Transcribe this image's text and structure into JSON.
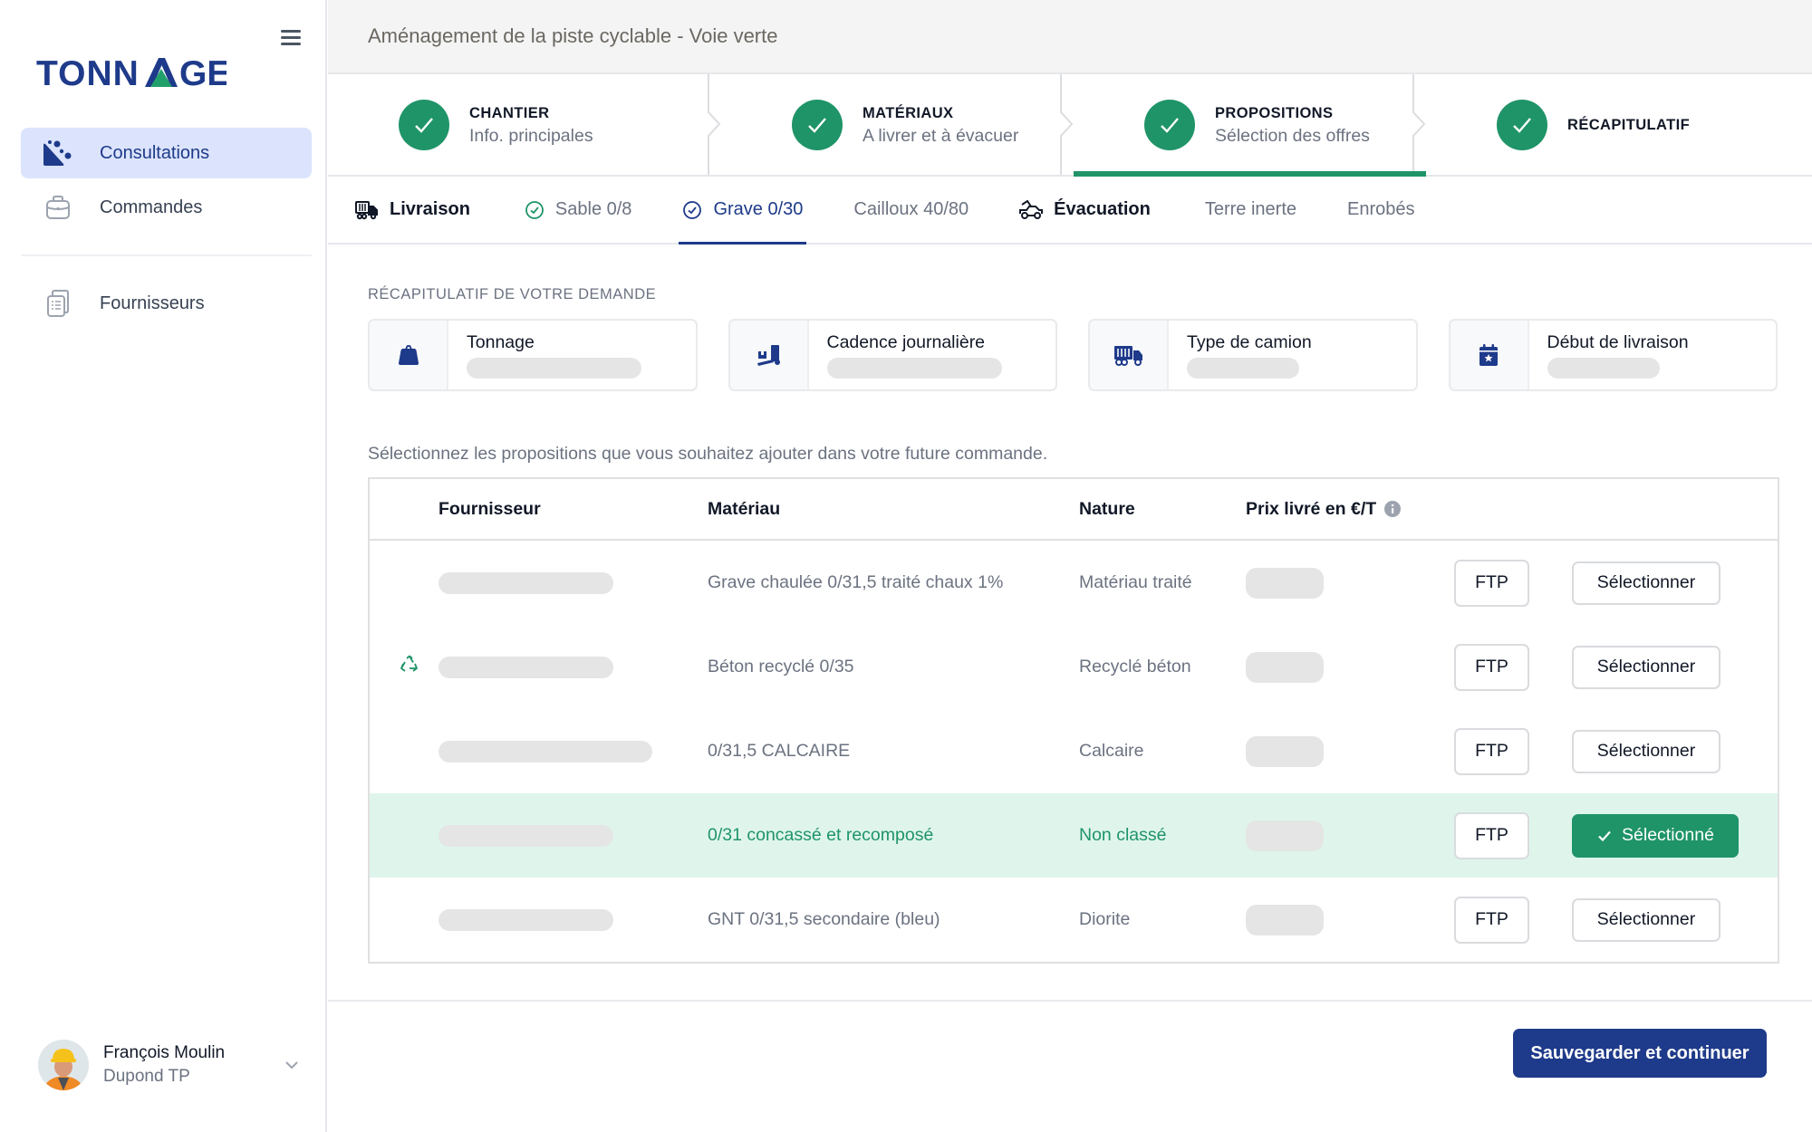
{
  "app": {
    "logo_text": "TONNAGE",
    "brand_color": "#1e3a8a",
    "accent_color": "#1f9468"
  },
  "sidebar": {
    "items": [
      {
        "label": "Consultations",
        "icon": "consultations-icon",
        "active": true
      },
      {
        "label": "Commandes",
        "icon": "briefcase-icon",
        "active": false
      },
      {
        "label": "Fournisseurs",
        "icon": "clipboard-icon",
        "active": false
      }
    ],
    "user": {
      "name": "François Moulin",
      "company": "Dupond TP"
    }
  },
  "header": {
    "title": "Aménagement de la piste cyclable - Voie verte"
  },
  "stepper": [
    {
      "title": "CHANTIER",
      "subtitle": "Info. principales",
      "status": "done"
    },
    {
      "title": "MATÉRIAUX",
      "subtitle": "A livrer et à évacuer",
      "status": "done"
    },
    {
      "title": "PROPOSITIONS",
      "subtitle": "Sélection des offres",
      "status": "active"
    },
    {
      "title": "RÉCAPITULATIF",
      "subtitle": "",
      "status": "done"
    }
  ],
  "tabs": [
    {
      "label": "Livraison",
      "type": "group",
      "icon": "delivery-truck-icon"
    },
    {
      "label": "Sable 0/8",
      "type": "done",
      "icon": "check-circle-icon"
    },
    {
      "label": "Grave 0/30",
      "type": "active",
      "icon": "check-circle-icon"
    },
    {
      "label": "Cailloux 40/80",
      "type": "default"
    },
    {
      "label": "Évacuation",
      "type": "group",
      "icon": "tow-truck-icon"
    },
    {
      "label": "Terre inerte",
      "type": "default"
    },
    {
      "label": "Enrobés",
      "type": "default"
    }
  ],
  "summary": {
    "label": "RÉCAPITULATIF DE VOTRE DEMANDE",
    "cards": [
      {
        "label": "Tonnage",
        "icon": "weight-icon"
      },
      {
        "label": "Cadence journalière",
        "icon": "hand-truck-icon"
      },
      {
        "label": "Type de camion",
        "icon": "truck-icon"
      },
      {
        "label": "Début de livraison",
        "icon": "calendar-star-icon"
      }
    ]
  },
  "proposals": {
    "hint": "Sélectionnez les propositions que vous souhaitez ajouter dans votre future commande.",
    "columns": {
      "supplier": "Fournisseur",
      "material": "Matériau",
      "nature": "Nature",
      "price": "Prix livré en €/T"
    },
    "ftp_label": "FTP",
    "select_label": "Sélectionner",
    "selected_label": "Sélectionné",
    "rows": [
      {
        "material": "Grave chaulée 0/31,5 traité chaux 1%",
        "nature": "Matériau traité",
        "recycled": false,
        "selected": false
      },
      {
        "material": "Béton recyclé 0/35",
        "nature": "Recyclé béton",
        "recycled": true,
        "selected": false
      },
      {
        "material": "0/31,5 CALCAIRE",
        "nature": "Calcaire",
        "recycled": false,
        "selected": false
      },
      {
        "material": "0/31 concassé et recomposé",
        "nature": "Non classé",
        "recycled": false,
        "selected": true
      },
      {
        "material": "GNT 0/31,5 secondaire (bleu)",
        "nature": "Diorite",
        "recycled": false,
        "selected": false
      }
    ]
  },
  "footer": {
    "save_label": "Sauvegarder et continuer"
  }
}
